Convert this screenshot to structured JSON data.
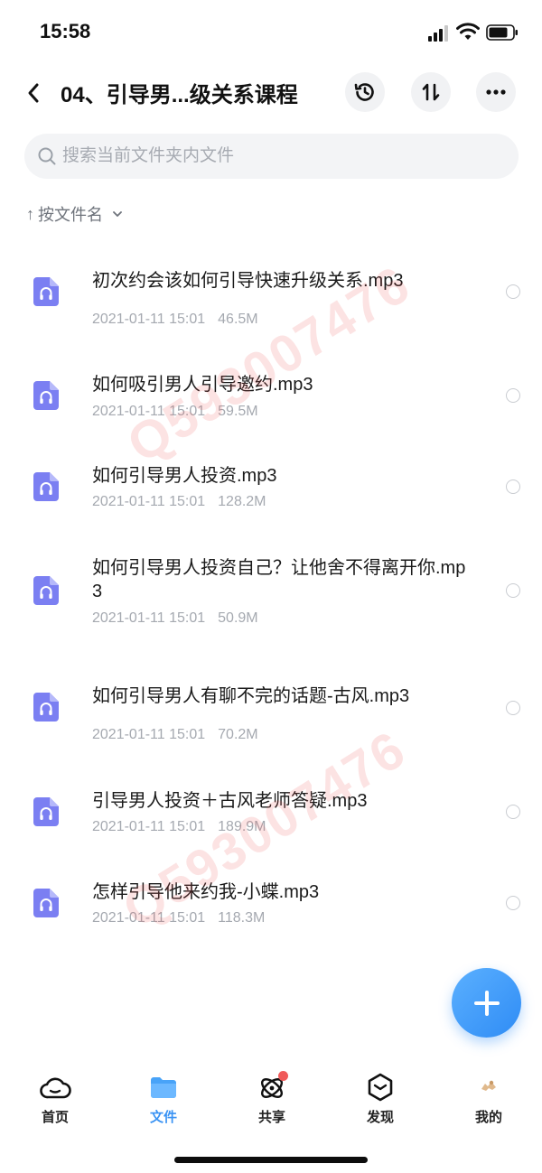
{
  "status_bar": {
    "time": "15:58"
  },
  "header": {
    "title": "04、引导男...级关系课程"
  },
  "search": {
    "placeholder": "搜索当前文件夹内文件"
  },
  "sort": {
    "arrow": "↑",
    "label": "按文件名"
  },
  "files": [
    {
      "name": "初次约会该如何引导快速升级关系.mp3",
      "date": "2021-01-11 15:01",
      "size": "46.5M"
    },
    {
      "name": "如何吸引男人引导邀约.mp3",
      "date": "2021-01-11 15:01",
      "size": "59.5M"
    },
    {
      "name": "如何引导男人投资.mp3",
      "date": "2021-01-11 15:01",
      "size": "128.2M"
    },
    {
      "name": "如何引导男人投资自己？让他舍不得离开你.mp3",
      "date": "2021-01-11 15:01",
      "size": "50.9M"
    },
    {
      "name": "如何引导男人有聊不完的话题-古风.mp3",
      "date": "2021-01-11 15:01",
      "size": "70.2M"
    },
    {
      "name": "引导男人投资＋古风老师答疑.mp3",
      "date": "2021-01-11 15:01",
      "size": "189.9M"
    },
    {
      "name": "怎样引导他来约我-小蝶.mp3",
      "date": "2021-01-11 15:01",
      "size": "118.3M"
    }
  ],
  "watermark": {
    "text": "Q593007476"
  },
  "tabs": [
    {
      "label": "首页",
      "icon": "cloud-icon"
    },
    {
      "label": "文件",
      "icon": "folder-icon",
      "active": true
    },
    {
      "label": "共享",
      "icon": "share-orbit-icon",
      "badge": true
    },
    {
      "label": "发现",
      "icon": "discover-cube-icon"
    },
    {
      "label": "我的",
      "icon": "avatar-icon"
    }
  ],
  "colors": {
    "accent": "#3a93f4",
    "file_icon": "#7b7ff2",
    "badge": "#f05a5a"
  }
}
